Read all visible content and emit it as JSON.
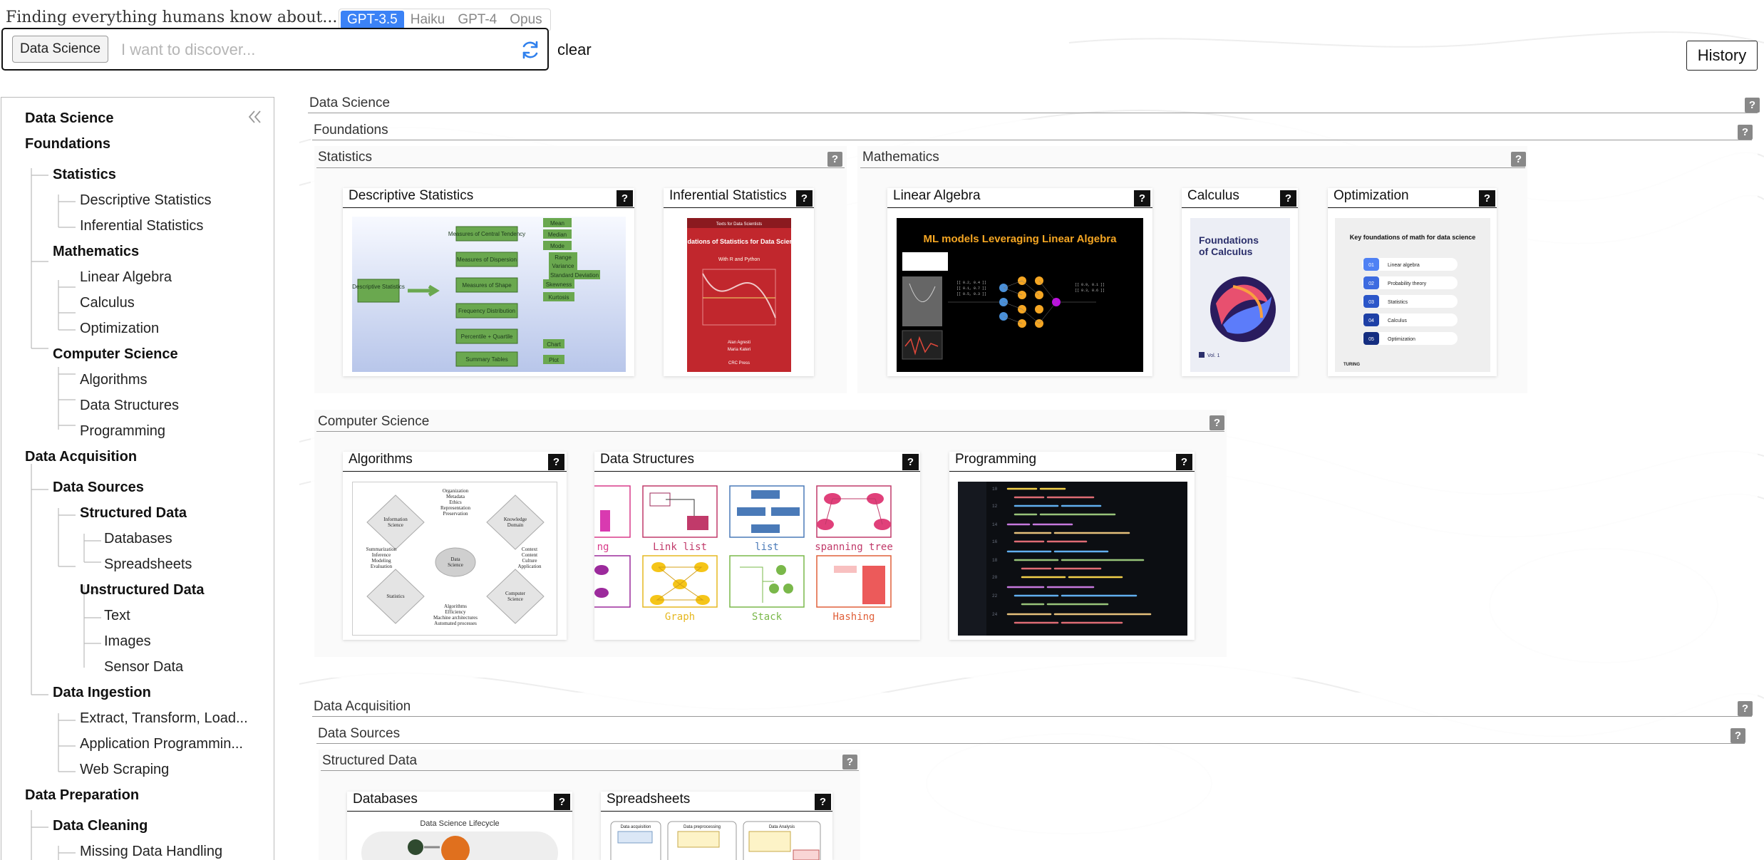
{
  "header": {
    "tagline": "Finding everything humans know about...",
    "models": [
      "GPT-3.5",
      "Haiku",
      "GPT-4",
      "Opus"
    ],
    "active_model": "GPT-3.5",
    "topic_chip": "Data Science",
    "search_placeholder": "I want to discover...",
    "clear_label": "clear",
    "history_label": "History"
  },
  "sidebar": {
    "items": [
      {
        "label": "Data Science",
        "level": 0
      },
      {
        "label": "Foundations",
        "level": 0
      },
      {
        "label": "Statistics",
        "level": 1
      },
      {
        "label": "Descriptive Statistics",
        "level": 2
      },
      {
        "label": "Inferential Statistics",
        "level": 2
      },
      {
        "label": "Mathematics",
        "level": 1
      },
      {
        "label": "Linear Algebra",
        "level": 2
      },
      {
        "label": "Calculus",
        "level": 2
      },
      {
        "label": "Optimization",
        "level": 2
      },
      {
        "label": "Computer Science",
        "level": 1
      },
      {
        "label": "Algorithms",
        "level": 2
      },
      {
        "label": "Data Structures",
        "level": 2
      },
      {
        "label": "Programming",
        "level": 2
      },
      {
        "label": "Data Acquisition",
        "level": 0
      },
      {
        "label": "Data Sources",
        "level": 1
      },
      {
        "label": "Structured Data",
        "level": 2
      },
      {
        "label": "Databases",
        "level": 3
      },
      {
        "label": "Spreadsheets",
        "level": 3
      },
      {
        "label": "Unstructured Data",
        "level": 2
      },
      {
        "label": "Text",
        "level": 3
      },
      {
        "label": "Images",
        "level": 3
      },
      {
        "label": "Sensor Data",
        "level": 3
      },
      {
        "label": "Data Ingestion",
        "level": 1
      },
      {
        "label": "Extract, Transform, Load...",
        "level": 2
      },
      {
        "label": "Application Programmin...",
        "level": 2
      },
      {
        "label": "Web Scraping",
        "level": 2
      },
      {
        "label": "Data Preparation",
        "level": 0
      },
      {
        "label": "Data Cleaning",
        "level": 1
      },
      {
        "label": "Missing Data Handling",
        "level": 2
      }
    ]
  },
  "main": {
    "sections": {
      "data_science": "Data Science",
      "foundations": "Foundations",
      "statistics": "Statistics",
      "mathematics": "Mathematics",
      "computer_science": "Computer Science",
      "data_acquisition": "Data Acquisition",
      "data_sources": "Data Sources",
      "structured_data": "Structured Data"
    },
    "cards": {
      "descriptive_statistics": "Descriptive Statistics",
      "inferential_statistics": "Inferential Statistics",
      "linear_algebra": "Linear Algebra",
      "calculus": "Calculus",
      "optimization": "Optimization",
      "algorithms": "Algorithms",
      "data_structures": "Data Structures",
      "programming": "Programming",
      "databases": "Databases",
      "spreadsheets": "Spreadsheets"
    },
    "q_mark": "?",
    "images": {
      "desc_stats": {
        "root": "Descriptive Statistics",
        "branches": [
          "Measures of Central Tendency",
          "Measures of Dispersion",
          "Measures of Shape",
          "Frequency Distribution",
          "Percentile + Quartile",
          "Summary Tables"
        ],
        "leaves": [
          "Mean",
          "Median",
          "Mode",
          "Range",
          "Variance",
          "Standard Deviation",
          "Skewness",
          "Kurtosis",
          "Chart",
          "Plot"
        ]
      },
      "inferential_book": {
        "series": "Texts for Data Scientists",
        "title": "Foundations of Statistics for Data Scientists",
        "subtitle": "With R and Python",
        "authors": [
          "Alan Agresti",
          "Maria Kateri"
        ],
        "publisher": "CRC Press"
      },
      "linear_algebra": {
        "title": "ML models Leveraging Linear Algebra"
      },
      "calculus_book": {
        "title": "Foundations of Calculus",
        "volume": "Vol. 1"
      },
      "optimization": {
        "title": "Key foundations of math for data science",
        "items": [
          {
            "num": "01",
            "label": "Linear algebra"
          },
          {
            "num": "02",
            "label": "Probability theory"
          },
          {
            "num": "03",
            "label": "Statistics"
          },
          {
            "num": "04",
            "label": "Calculus"
          },
          {
            "num": "05",
            "label": "Optimization"
          }
        ],
        "brand": "TURING"
      },
      "algorithms": {
        "center": "Data Science",
        "diamonds": [
          "Information Science",
          "Knowledge Domain",
          "Statistics",
          "Computer Science"
        ],
        "text_top": "Organization\nMetadata\nEthics\nRepresentation\nPreservation",
        "text_left": "Summarization\nInference\nModeling\nEvaluation",
        "text_right": "Context\nContent\nCulture\nApplication",
        "text_bottom": "Algorithms\nEfficiency\nMachine architectures\nAutomated processes"
      },
      "data_structures": {
        "labels": [
          "ng",
          "Link list",
          "list",
          "spanning tree",
          "",
          "Graph",
          "Stack",
          "Hashing"
        ]
      },
      "databases": {
        "title": "Data Science Lifecycle"
      },
      "spreadsheets": {
        "headers": [
          "Data acquisition",
          "Data preprocessing",
          "Data Analysis"
        ]
      }
    }
  }
}
